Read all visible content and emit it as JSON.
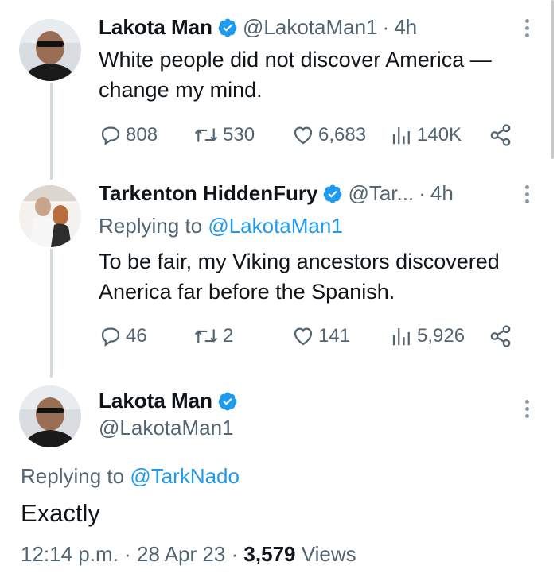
{
  "tweets": [
    {
      "name": "Lakota Man",
      "handle": "@LakotaMan1",
      "time": "4h",
      "text": "White people did not discover America — change my mind.",
      "text_lines": [
        "White people did not discover America —",
        "change my mind."
      ],
      "stats": {
        "replies": "808",
        "retweets": "530",
        "likes": "6,683",
        "views": "140K"
      }
    },
    {
      "name": "Tarkenton HiddenFury",
      "handle": "@Tar...",
      "time": "4h",
      "replying_prefix": "Replying to",
      "replying_to": "@LakotaMan1",
      "text_lines": [
        "To be fair, my Viking ancestors discovered",
        "Anerica far before the Spanish."
      ],
      "stats": {
        "replies": "46",
        "retweets": "2",
        "likes": "141",
        "views": "5,926"
      }
    }
  ],
  "main_tweet": {
    "name": "Lakota Man",
    "handle": "@LakotaMan1",
    "replying_prefix": "Replying to",
    "replying_to": "@TarkNado",
    "text": "Exactly",
    "time": "12:14 p.m.",
    "date": "28 Apr 23",
    "views_count": "3,579",
    "views_label": "Views"
  },
  "colors": {
    "accent": "#1d9bf0",
    "secondary_text": "#536471",
    "primary_text": "#0f1419",
    "thread_line": "#cfd9de"
  }
}
